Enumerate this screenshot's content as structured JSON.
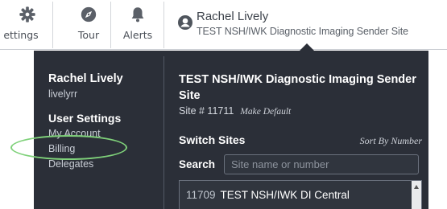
{
  "nav": {
    "settings_label": "ettings",
    "tour_label": "Tour",
    "alerts_label": "Alerts"
  },
  "user": {
    "name": "Rachel Lively",
    "site": "TEST NSH/IWK Diagnostic Imaging Sender Site"
  },
  "menu": {
    "user_name": "Rachel Lively",
    "username": "livelyrr",
    "section_title": "User Settings",
    "items": [
      {
        "label": "My Account"
      },
      {
        "label": "Billing"
      },
      {
        "label": "Delegates"
      }
    ]
  },
  "site": {
    "title": "TEST NSH/IWK Diagnostic Imaging Sender Site",
    "number": "Site # 11711",
    "make_default": "Make Default"
  },
  "switch": {
    "title": "Switch Sites",
    "sort_label": "Sort By Number",
    "search_label": "Search",
    "search_placeholder": "Site name or number",
    "sites": [
      {
        "code": "11709",
        "name": "TEST NSH/IWK DI Central"
      }
    ]
  },
  "colors": {
    "panel_bg": "#2b2f38",
    "highlight": "#7fd17a"
  }
}
